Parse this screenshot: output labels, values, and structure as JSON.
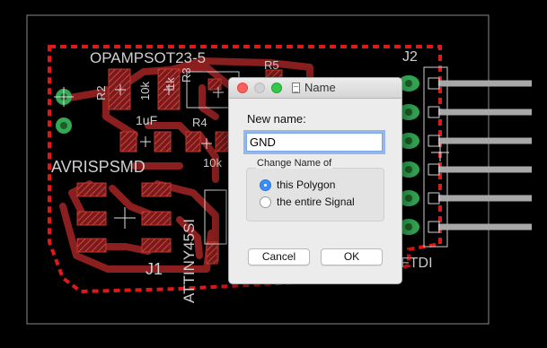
{
  "board": {
    "labels": {
      "opamp": "OPAMPSOT23-5",
      "r2": "R2",
      "r2_value": "10k",
      "r3_value": "1k",
      "r3": "R3",
      "r5": "R5",
      "cap_value": "1uF",
      "r4": "R4",
      "r4_value": "10k",
      "avrisp": "AVRISPSMD",
      "attiny": "ATTINY45SI",
      "j1": "J1",
      "j2": "J2",
      "ftdi": "FTDI"
    },
    "colors": {
      "background": "#000000",
      "copper": "#8b1f1f",
      "pad_hatch": "#c0392b",
      "polygon_outline": "#e01818",
      "via_green": "#34a853",
      "silkscreen": "#cfcfcf",
      "header_pins": "#a8a8a8"
    }
  },
  "dialog": {
    "title": "Name",
    "title_icon": "document-icon",
    "new_name_label": "New name:",
    "new_name_value": "GND",
    "group_label": "Change Name of",
    "option_polygon": "this Polygon",
    "option_signal": "the entire Signal",
    "selected_option": "this Polygon",
    "cancel_label": "Cancel",
    "ok_label": "OK"
  }
}
